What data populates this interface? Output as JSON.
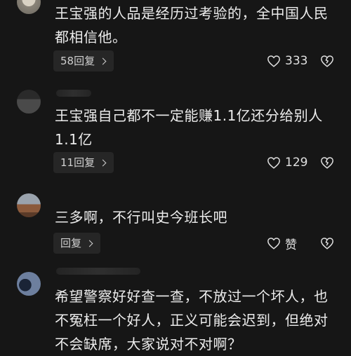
{
  "comments": [
    {
      "text_lines": [
        "王宝强的人品是经历过考验的，全中国人民",
        "都相信他。"
      ],
      "reply_label": "58回复",
      "like_count": "333"
    },
    {
      "text_lines": [
        "王宝强自己都不一定能赚1.1亿还分给别人",
        "1.1亿"
      ],
      "reply_label": "11回复",
      "like_count": "129"
    },
    {
      "text_lines": [
        "三多啊，不行叫史今班长吧"
      ],
      "reply_label": "回复",
      "like_count": "赞"
    },
    {
      "text_lines": [
        "希望警察好好查一查，不放过一个坏人，也",
        "不冤枉一个好人，正义可能会迟到，但绝对",
        "不会缺席，大家说对不对啊？"
      ]
    }
  ],
  "icons": {
    "like": "heart-outline-icon",
    "dislike": "broken-heart-icon",
    "reply_arrow": "chevron-right-icon"
  },
  "colors": {
    "background": "#161616",
    "text": "#ececec",
    "button_bg": "#262626"
  }
}
